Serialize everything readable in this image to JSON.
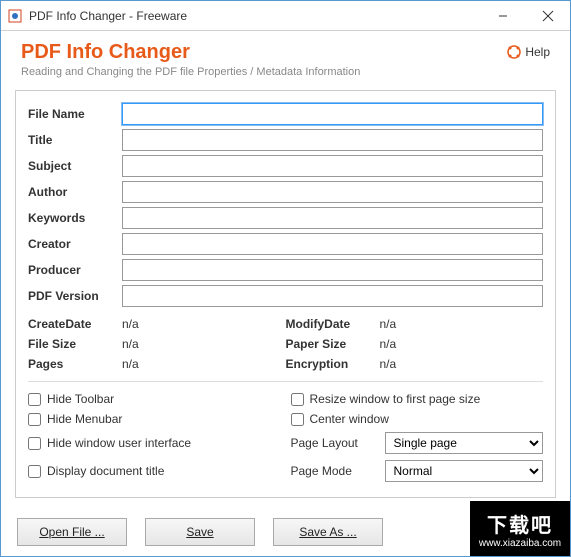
{
  "titlebar": {
    "text": "PDF Info Changer - Freeware"
  },
  "header": {
    "title": "PDF Info Changer",
    "subtitle": "Reading and Changing the PDF file Properties / Metadata Information",
    "help_label": "Help"
  },
  "fields": {
    "file_name": {
      "label": "File Name",
      "value": ""
    },
    "title": {
      "label": "Title",
      "value": ""
    },
    "subject": {
      "label": "Subject",
      "value": ""
    },
    "author": {
      "label": "Author",
      "value": ""
    },
    "keywords": {
      "label": "Keywords",
      "value": ""
    },
    "creator": {
      "label": "Creator",
      "value": ""
    },
    "producer": {
      "label": "Producer",
      "value": ""
    },
    "pdf_version": {
      "label": "PDF Version",
      "value": ""
    }
  },
  "meta": {
    "create_date": {
      "label": "CreateDate",
      "value": "n/a"
    },
    "modify_date": {
      "label": "ModifyDate",
      "value": "n/a"
    },
    "file_size": {
      "label": "File Size",
      "value": "n/a"
    },
    "paper_size": {
      "label": "Paper Size",
      "value": "n/a"
    },
    "pages": {
      "label": "Pages",
      "value": "n/a"
    },
    "encryption": {
      "label": "Encryption",
      "value": "n/a"
    }
  },
  "opts": {
    "hide_toolbar": "Hide Toolbar",
    "hide_menubar": "Hide Menubar",
    "hide_window_ui": "Hide window user interface",
    "display_doc_title": "Display document title",
    "resize_first_page": "Resize window to first page size",
    "center_window": "Center window",
    "page_layout_label": "Page Layout",
    "page_layout_value": "Single page",
    "page_mode_label": "Page Mode",
    "page_mode_value": "Normal"
  },
  "buttons": {
    "open": "Open File ...",
    "save": "Save",
    "save_as": "Save As ..."
  },
  "watermark": {
    "big": "下载吧",
    "url": "www.xiazaiba.com"
  }
}
